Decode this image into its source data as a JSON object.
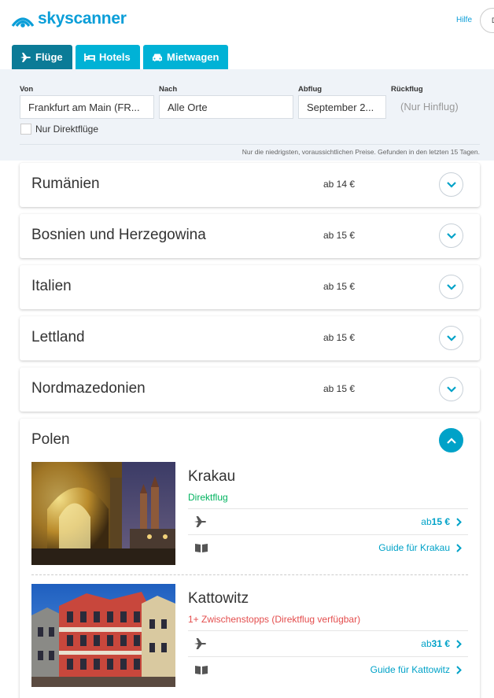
{
  "header": {
    "logo_text": "skyscanner",
    "help_link": "Hilfe",
    "lang_button": "D"
  },
  "tabs": [
    {
      "label": "Flüge",
      "icon": "plane-icon",
      "active": true
    },
    {
      "label": "Hotels",
      "icon": "bed-icon",
      "active": false
    },
    {
      "label": "Mietwagen",
      "icon": "car-icon",
      "active": false
    }
  ],
  "search": {
    "from_label": "Von",
    "from_value": "Frankfurt am Main (FR...",
    "to_label": "Nach",
    "to_value": "Alle Orte",
    "depart_label": "Abflug",
    "depart_value": "September 2...",
    "return_label": "Rückflug",
    "return_value": "(Nur Hinflug)",
    "direct_only_label": "Nur Direktflüge",
    "disclaimer": "Nur die niedrigsten, voraussichtlichen Preise. Gefunden in den letzten 15 Tagen."
  },
  "countries": [
    {
      "name": "Rumänien",
      "price": "ab 14 €"
    },
    {
      "name": "Bosnien und Herzegowina",
      "price": "ab 15 €"
    },
    {
      "name": "Italien",
      "price": "ab 15 €"
    },
    {
      "name": "Lettland",
      "price": "ab 15 €"
    },
    {
      "name": "Nordmazedonien",
      "price": "ab 15 €"
    }
  ],
  "expanded": {
    "name": "Polen",
    "cities": [
      {
        "name": "Krakau",
        "stops": "Direktflug",
        "flight_prefix": "ab ",
        "flight_price": "15 €",
        "guide": "Guide für Krakau"
      },
      {
        "name": "Kattowitz",
        "stops": "1+ Zwischenstopps (Direktflug verfügbar)",
        "flight_prefix": "ab ",
        "flight_price": "31 €",
        "guide": "Guide für Kattowitz"
      }
    ]
  },
  "colors": {
    "brand": "#0b9ed8",
    "tab": "#00b2d6",
    "tab_active": "#0b7b97",
    "link": "#00a2c8",
    "direct": "#00b35f",
    "stops": "#e44e4e"
  }
}
